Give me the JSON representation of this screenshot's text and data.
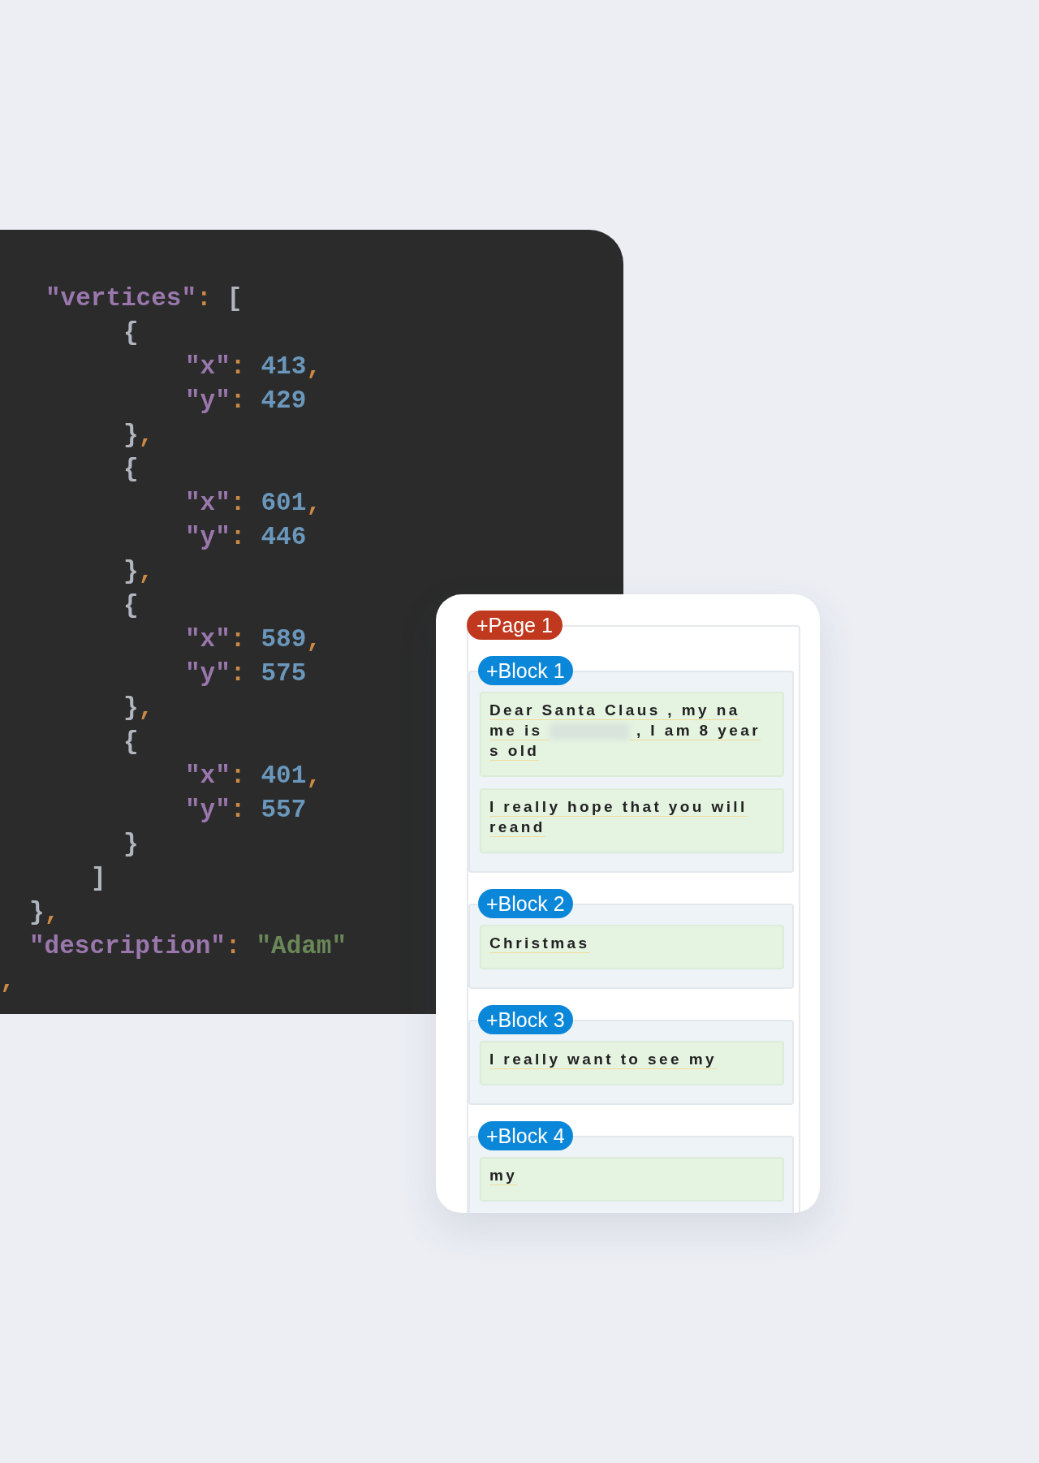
{
  "code_panel": {
    "lines": [
      {
        "kind": "property",
        "tokens": [
          {
            "kind": "key",
            "text": "\"vertices\""
          },
          {
            "kind": "punct",
            "text": ":"
          },
          {
            "kind": "brace",
            "text": "["
          }
        ]
      },
      {
        "kind": "object",
        "tokens": [
          {
            "kind": "brace",
            "text": "{"
          }
        ]
      },
      {
        "kind": "field",
        "tokens": [
          {
            "kind": "key",
            "text": "\"x\""
          },
          {
            "kind": "punct",
            "text": ":"
          },
          {
            "kind": "number",
            "text": "413"
          },
          {
            "kind": "punct",
            "text": ","
          }
        ]
      },
      {
        "kind": "field",
        "tokens": [
          {
            "kind": "key",
            "text": "\"y\""
          },
          {
            "kind": "punct",
            "text": ":"
          },
          {
            "kind": "number",
            "text": "429"
          }
        ]
      },
      {
        "kind": "object",
        "tokens": [
          {
            "kind": "brace",
            "text": "}"
          },
          {
            "kind": "punct",
            "text": ","
          }
        ]
      },
      {
        "kind": "object",
        "tokens": [
          {
            "kind": "brace",
            "text": "{"
          }
        ]
      },
      {
        "kind": "field",
        "tokens": [
          {
            "kind": "key",
            "text": "\"x\""
          },
          {
            "kind": "punct",
            "text": ":"
          },
          {
            "kind": "number",
            "text": "601"
          },
          {
            "kind": "punct",
            "text": ","
          }
        ]
      },
      {
        "kind": "field",
        "tokens": [
          {
            "kind": "key",
            "text": "\"y\""
          },
          {
            "kind": "punct",
            "text": ":"
          },
          {
            "kind": "number",
            "text": "446"
          }
        ]
      },
      {
        "kind": "object",
        "tokens": [
          {
            "kind": "brace",
            "text": "}"
          },
          {
            "kind": "punct",
            "text": ","
          }
        ]
      },
      {
        "kind": "object",
        "tokens": [
          {
            "kind": "brace",
            "text": "{"
          }
        ]
      },
      {
        "kind": "field",
        "tokens": [
          {
            "kind": "key",
            "text": "\"x\""
          },
          {
            "kind": "punct",
            "text": ":"
          },
          {
            "kind": "number",
            "text": "589"
          },
          {
            "kind": "punct",
            "text": ","
          }
        ]
      },
      {
        "kind": "field",
        "tokens": [
          {
            "kind": "key",
            "text": "\"y\""
          },
          {
            "kind": "punct",
            "text": ":"
          },
          {
            "kind": "number",
            "text": "575"
          }
        ]
      },
      {
        "kind": "object",
        "tokens": [
          {
            "kind": "brace",
            "text": "}"
          },
          {
            "kind": "punct",
            "text": ","
          }
        ]
      },
      {
        "kind": "object",
        "tokens": [
          {
            "kind": "brace",
            "text": "{"
          }
        ]
      },
      {
        "kind": "field",
        "tokens": [
          {
            "kind": "key",
            "text": "\"x\""
          },
          {
            "kind": "punct",
            "text": ":"
          },
          {
            "kind": "number",
            "text": "401"
          },
          {
            "kind": "punct",
            "text": ","
          }
        ]
      },
      {
        "kind": "field",
        "tokens": [
          {
            "kind": "key",
            "text": "\"y\""
          },
          {
            "kind": "punct",
            "text": ":"
          },
          {
            "kind": "number",
            "text": "557"
          }
        ]
      },
      {
        "kind": "object",
        "tokens": [
          {
            "kind": "brace",
            "text": "}"
          }
        ]
      },
      {
        "kind": "array",
        "tokens": [
          {
            "kind": "brace",
            "text": "]"
          }
        ]
      },
      {
        "kind": "top",
        "tokens": [
          {
            "kind": "brace",
            "text": "}"
          },
          {
            "kind": "punct",
            "text": ","
          }
        ]
      },
      {
        "kind": "top",
        "tokens": [
          {
            "kind": "key",
            "text": "\"description\""
          },
          {
            "kind": "punct",
            "text": ":"
          },
          {
            "kind": "string",
            "text": "\"Adam\""
          }
        ]
      },
      {
        "kind": "edge",
        "tokens": [
          {
            "kind": "punct",
            "text": ","
          }
        ]
      }
    ]
  },
  "card": {
    "page_label": "+Page 1",
    "blocks": [
      {
        "label": "+Block 1",
        "paragraphs": [
          [
            {
              "kind": "text",
              "text": " Dear Santa Claus , my na\nme is "
            },
            {
              "kind": "redacted"
            },
            {
              "kind": "text",
              "text": " , I am 8 year\ns old"
            }
          ],
          [
            {
              "kind": "text",
              "text": " I really hope that you will\nreand"
            }
          ]
        ]
      },
      {
        "label": "+Block 2",
        "paragraphs": [
          [
            {
              "kind": "text",
              "text": " Christmas"
            }
          ]
        ]
      },
      {
        "label": "+Block 3",
        "paragraphs": [
          [
            {
              "kind": "text",
              "text": " I really want to see my"
            }
          ]
        ]
      },
      {
        "label": "+Block 4",
        "paragraphs": [
          [
            {
              "kind": "text",
              "text": " my"
            }
          ]
        ]
      }
    ]
  }
}
